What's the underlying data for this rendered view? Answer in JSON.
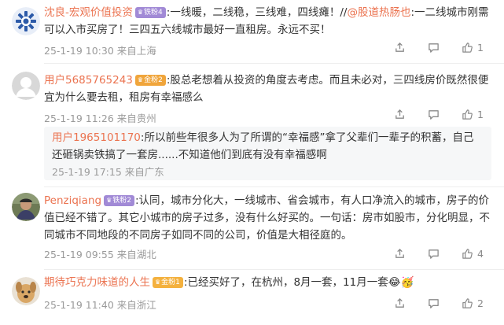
{
  "comments": [
    {
      "user": "沈良-宏观价值投资",
      "badge": "铁粉4",
      "prefix": ":",
      "text1": "一线暖，二线稳，三线难，四线瘫！//",
      "mention": "@股道热肠也",
      "text2": ":一二线城市刚需可以入市买房了！三四五六线城市最好一直租房。永远不买！",
      "time": "25-1-19 10:30",
      "location": "来自上海",
      "likes": "1"
    },
    {
      "user": "用户5685765243",
      "badge": "金粉2",
      "text": ":股总老想着从投资的角度去考虑。而且未必对，三四线房价既然很便宜为什么要去租，租房有幸福感么",
      "time": "25-1-19 11:26",
      "location": "来自贵州",
      "likes": "1",
      "reply": {
        "user": "用户1965101170",
        "text": ":所以前些年很多人为了所谓的“幸福感”拿了父辈们一辈子的积蓄，自己还砸锅卖铁搞了一套房......不知道他们到底有没有幸福感啊",
        "time": "25-1-19 17:15",
        "location": "来自广东"
      }
    },
    {
      "user": "Penziqiang",
      "badge": "铁粉2",
      "text": ":认同，城市分化大，一线城市、省会城市，有人口净流入的城市，房子的价值已经不错了。其它小城市的房子过多，没有什么好买的。一句话：房市如股市，分化明显，不同城市不同地段的不同房子如同不同的公司，价值是大相径庭的。",
      "time": "25-1-19 09:55",
      "location": "来自湖北",
      "likes": "4"
    },
    {
      "user": "期待巧克力味道的人生",
      "badge": "金粉1",
      "text": ":已经买好了，在杭州，8月一套，11月一套",
      "emoji": "😂🥳",
      "time": "25-1-19 11:40",
      "location": "来自浙江",
      "likes": "2"
    }
  ],
  "colors": {
    "username": "#eb7350",
    "meta": "#9a9a9a",
    "reply_bg": "#f6f7f8"
  },
  "icons": [
    "share-icon",
    "comment-icon",
    "like-icon"
  ]
}
